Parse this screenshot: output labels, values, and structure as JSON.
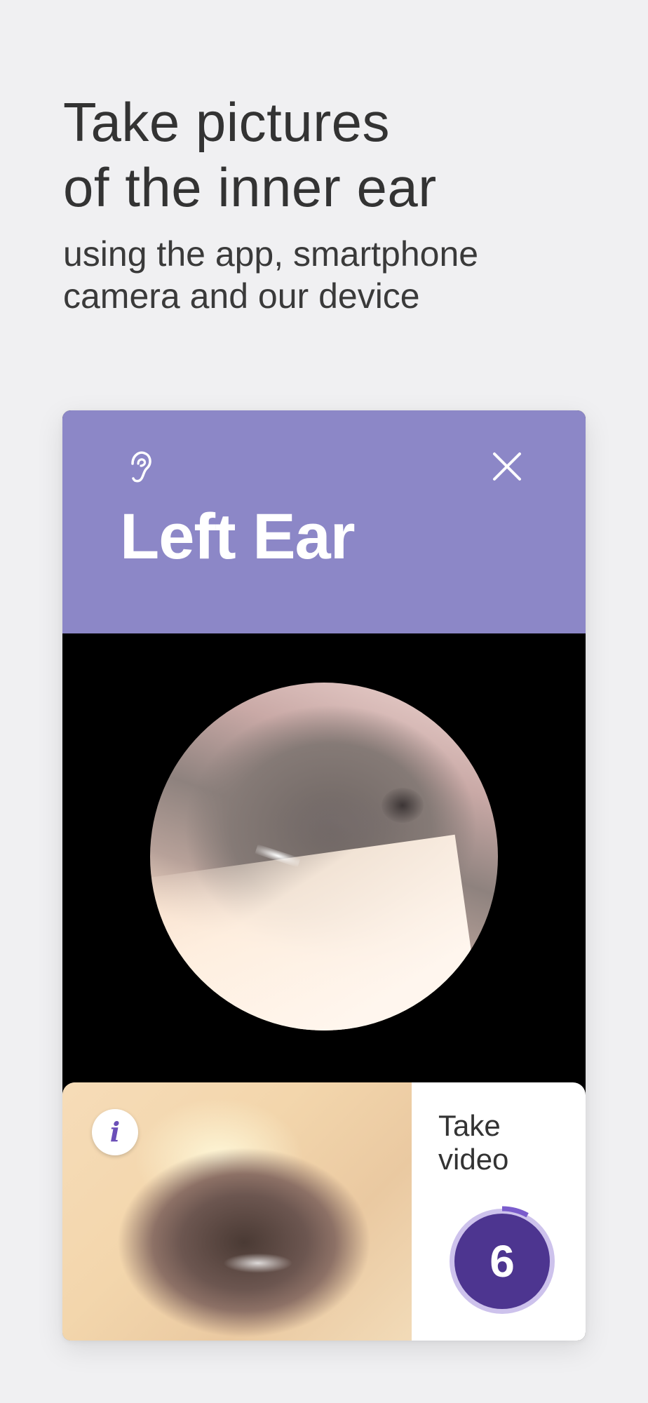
{
  "headline": {
    "lines": [
      "Take pictures",
      "of the inner ear"
    ]
  },
  "subheadline": {
    "lines": [
      "using the app, smartphone",
      "camera and our device"
    ]
  },
  "card": {
    "header_color": "#8c87c7",
    "title": "Left Ear",
    "ear_icon": "ear-icon",
    "close_icon": "close-icon"
  },
  "preview": {
    "info_icon": "info-icon",
    "info_glyph": "i"
  },
  "video": {
    "label_lines": [
      "Take",
      "video"
    ],
    "countdown": "6",
    "countdown_progress": 0.08,
    "accent_color": "#4d3590"
  }
}
